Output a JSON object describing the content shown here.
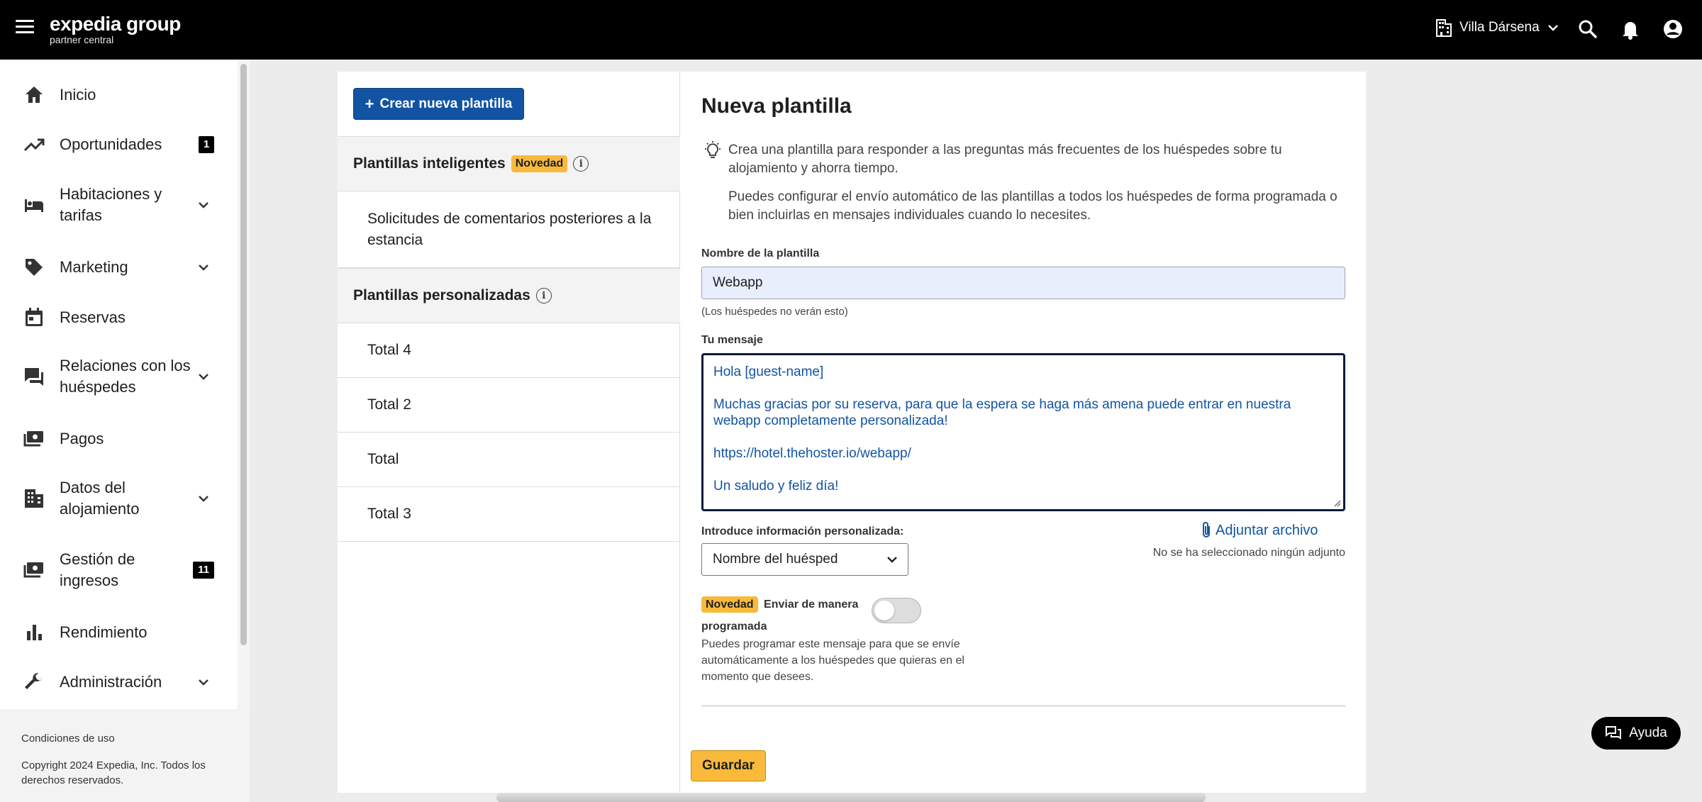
{
  "header": {
    "brand_main": "expedia group",
    "brand_sub": "partner central",
    "property_name": "Villa Dársena"
  },
  "sidebar": {
    "items": [
      {
        "label": "Inicio",
        "icon": "home-icon"
      },
      {
        "label": "Oportunidades",
        "icon": "trending-up-icon",
        "badge": "1"
      },
      {
        "label": "Habitaciones y tarifas",
        "icon": "bed-icon"
      },
      {
        "label": "Marketing",
        "icon": "tag-icon"
      },
      {
        "label": "Reservas",
        "icon": "calendar-icon"
      },
      {
        "label": "Relaciones con los huéspedes",
        "icon": "chat-icon"
      },
      {
        "label": "Pagos",
        "icon": "payments-icon"
      },
      {
        "label": "Datos del alojamiento",
        "icon": "building-icon"
      },
      {
        "label": "Gestión de ingresos",
        "icon": "revenue-icon",
        "badge": "11"
      },
      {
        "label": "Rendimiento",
        "icon": "bar-chart-icon"
      },
      {
        "label": "Administración",
        "icon": "wrench-icon"
      }
    ],
    "footer": {
      "terms": "Condiciones de uso",
      "copyright": "Copyright 2024 Expedia, Inc. Todos los derechos reservados."
    }
  },
  "templates": {
    "create_label": "Crear nueva plantilla",
    "smart_heading": "Plantillas inteligentes",
    "new_badge": "Novedad",
    "smart_items": [
      "Solicitudes de comentarios posteriores a la estancia"
    ],
    "custom_heading": "Plantillas personalizadas",
    "custom_items": [
      "Total 4",
      "Total 2",
      "Total",
      "Total 3"
    ]
  },
  "form": {
    "title": "Nueva plantilla",
    "tip_1": "Crea una plantilla para responder a las preguntas más frecuentes de los huéspedes sobre tu alojamiento y ahorra tiempo.",
    "tip_2": "Puedes configurar el envío automático de las plantillas a todos los huéspedes de forma programada o bien incluirlas en mensajes individuales cuando lo necesites.",
    "name_label": "Nombre de la plantilla",
    "name_value": "Webapp",
    "name_hint": "(Los huéspedes no verán esto)",
    "message_label": "Tu mensaje",
    "message_lines": [
      "Hola [guest-name]",
      "Muchas gracias por su reserva, para que la espera se haga más amena puede entrar en nuestra webapp completamente personalizada!",
      "https://hotel.thehoster.io/webapp/",
      "Un saludo y feliz día!"
    ],
    "custom_info_label": "Introduce información personalizada:",
    "custom_info_value": "Nombre del huésped",
    "attach_label": "Adjuntar archivo",
    "no_attachment": "No se ha seleccionado ningún adjunto",
    "schedule_badge": "Novedad",
    "schedule_label": "Enviar de manera programada",
    "schedule_desc": "Puedes programar este mensaje para que se envíe automáticamente a los huéspedes que quieras en el momento que desees.",
    "schedule_enabled": false,
    "save_label": "Guardar"
  },
  "help": {
    "label": "Ayuda"
  }
}
